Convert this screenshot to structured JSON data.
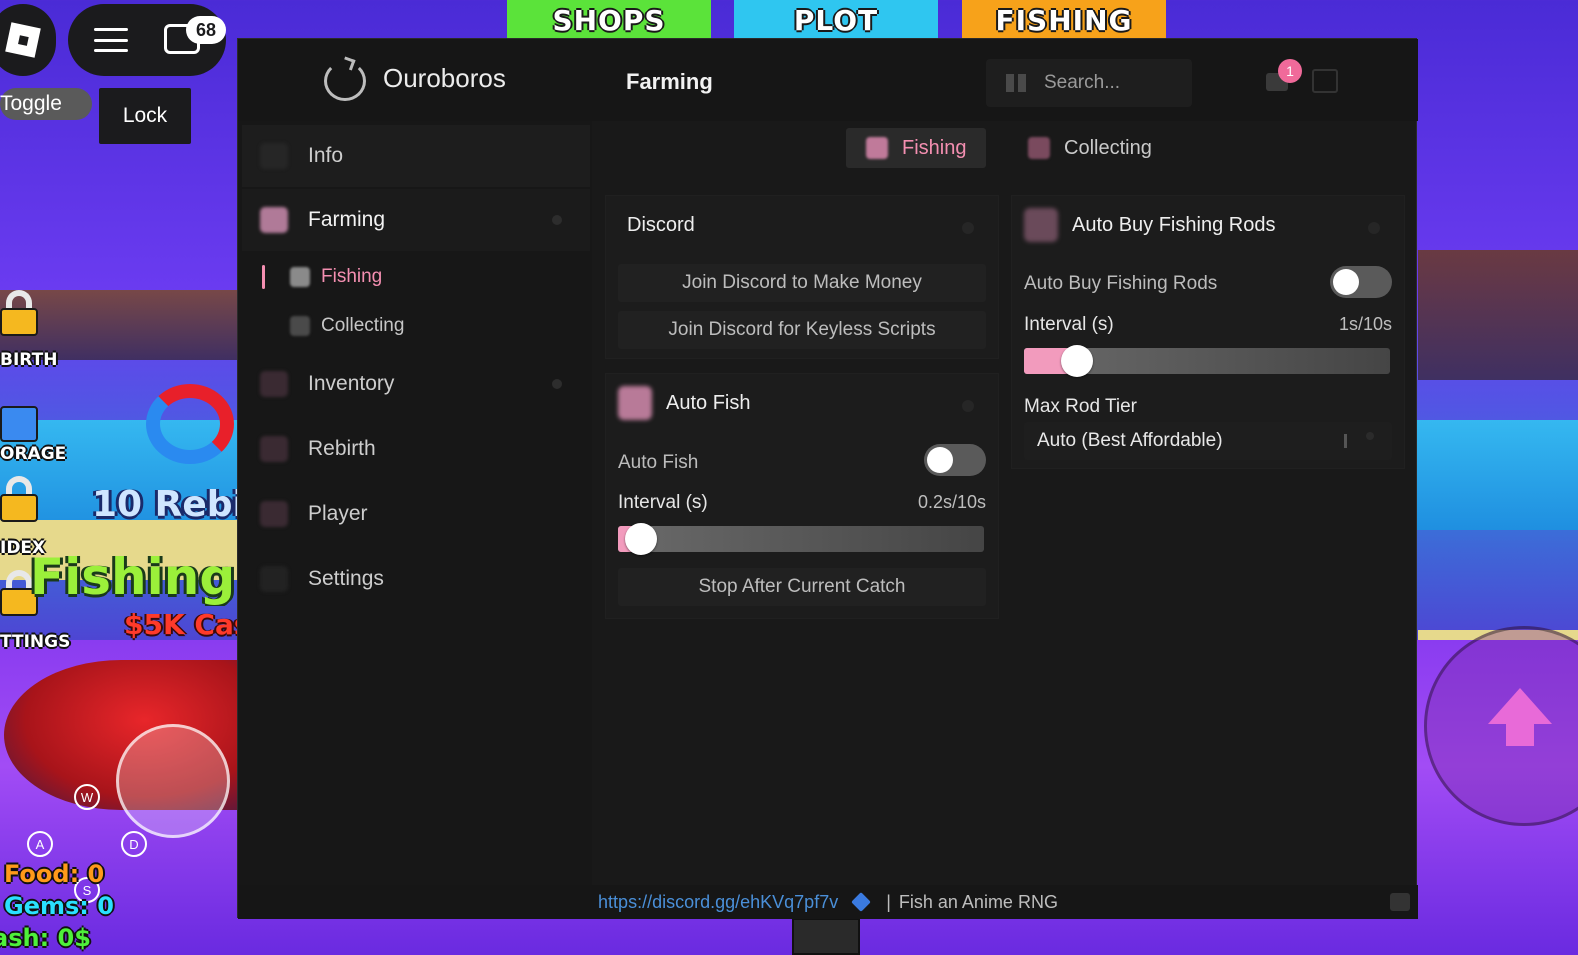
{
  "game": {
    "top_tabs": [
      "SHOPS",
      "PLOT",
      "FISHING"
    ],
    "chat_count": "68",
    "buttons": {
      "toggle": "Toggle",
      "lock": "Lock"
    },
    "locked_labels": [
      "BIRTH",
      "ORAGE",
      "IDEX",
      "TTINGS"
    ],
    "promo_rebirth": "10 Rebir",
    "promo_fishing": "Fishing D",
    "promo_cash": "$5K Cas",
    "keys": [
      "W",
      "A",
      "D",
      "S"
    ],
    "stats": {
      "food": "Food: 0",
      "gems": "Gems: 0",
      "cash": "ash: 0$"
    }
  },
  "window": {
    "app_title": "Ouroboros",
    "page_title": "Farming",
    "search": {
      "placeholder": "Search..."
    },
    "notification_count": "1",
    "sidebar": {
      "items": [
        {
          "label": "Info"
        },
        {
          "label": "Farming"
        },
        {
          "label": "Inventory"
        },
        {
          "label": "Rebirth"
        },
        {
          "label": "Player"
        },
        {
          "label": "Settings"
        }
      ],
      "sub_items": [
        {
          "label": "Fishing"
        },
        {
          "label": "Collecting"
        }
      ]
    },
    "tabs": [
      {
        "label": "Fishing"
      },
      {
        "label": "Collecting"
      }
    ],
    "discord_panel": {
      "title": "Discord",
      "buttons": [
        "Join Discord to Make Money",
        "Join Discord for Keyless Scripts"
      ]
    },
    "auto_fish_panel": {
      "title": "Auto Fish",
      "toggle_label": "Auto Fish",
      "toggle_on": false,
      "interval_label": "Interval (s)",
      "interval_value": "0.2s/10s",
      "interval_fraction": 0.02,
      "button": "Stop After Current Catch"
    },
    "auto_buy_panel": {
      "title": "Auto Buy Fishing Rods",
      "toggle_label": "Auto Buy Fishing Rods",
      "toggle_on": false,
      "interval_label": "Interval (s)",
      "interval_value": "1s/10s",
      "interval_fraction": 0.1,
      "tier_label": "Max Rod Tier",
      "tier_value": "Auto (Best Affordable)"
    },
    "footer": {
      "link": "https://discord.gg/ehKVq7pf7v",
      "separator": "|",
      "game_name": "Fish an Anime RNG"
    },
    "colors": {
      "accent": "#f48fb1",
      "link": "#4a8fd8",
      "bg": "#191919"
    }
  }
}
